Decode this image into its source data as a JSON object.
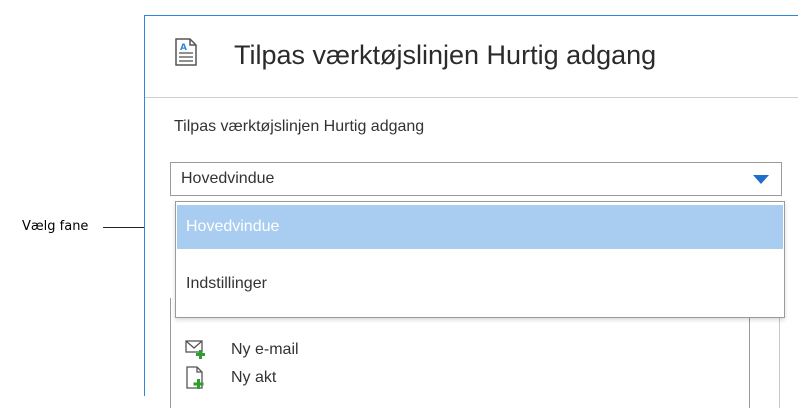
{
  "callout": {
    "label": "Vælg fane"
  },
  "dialog": {
    "title": "Tilpas værktøjslinjen Hurtig adgang",
    "section_label": "Tilpas værktøjslinjen Hurtig adgang",
    "select": {
      "value": "Hovedvindue"
    },
    "dropdown": {
      "options": [
        {
          "label": "Hovedvindue",
          "selected": true
        },
        {
          "label": "Indstillinger",
          "selected": false
        }
      ]
    },
    "list": {
      "items": [
        {
          "label": "Ny e-mail",
          "icon": "new-email-icon"
        },
        {
          "label": "Ny akt",
          "icon": "new-document-icon"
        }
      ]
    }
  },
  "colors": {
    "accent": "#2e88d6",
    "selected_bg": "#a8cdf0",
    "arrow": "#1e6fc7",
    "icon_green": "#2e9e2e"
  }
}
